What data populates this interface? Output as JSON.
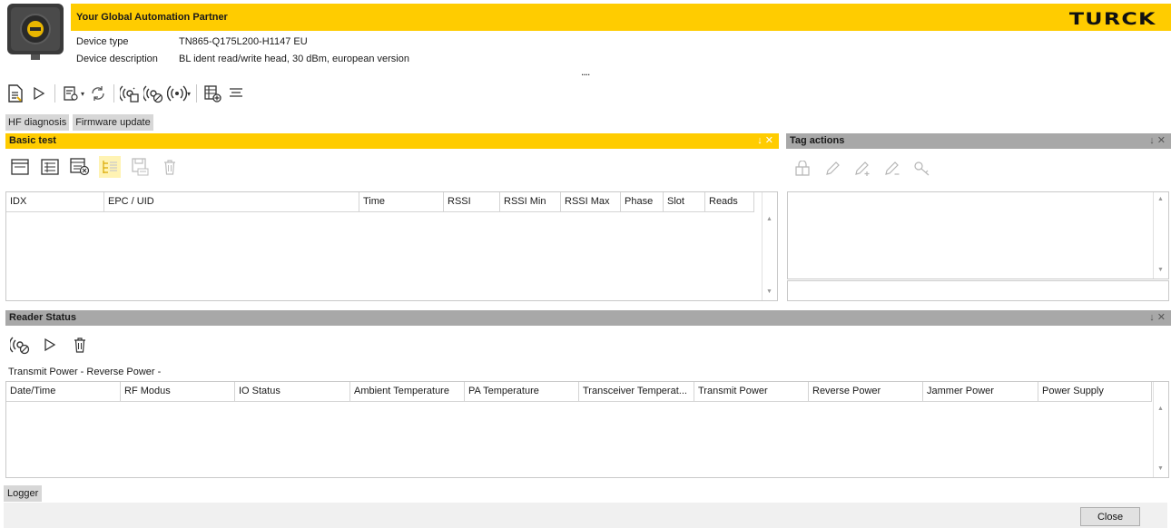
{
  "header": {
    "tagline": "Your Global Automation Partner",
    "brand": "TURCK",
    "device_type_label": "Device type",
    "device_type_value": "TN865-Q175L200-H1147 EU",
    "device_desc_label": "Device description",
    "device_desc_value": "BL ident read/write head, 30 dBm, european version",
    "more": "...."
  },
  "toolbar": {
    "items": [
      "report-icon",
      "play-icon",
      "config-icon",
      "refresh-icon",
      "antenna-tag-icon",
      "antenna-check-icon",
      "wireless-icon",
      "table-add-icon",
      "align-icon"
    ]
  },
  "tabs": [
    "HF diagnosis",
    "Firmware update"
  ],
  "basic_test": {
    "title": "Basic test",
    "pin": "↓ ✕",
    "columns": [
      "IDX",
      "EPC / UID",
      "Time",
      "RSSI",
      "RSSI Min",
      "RSSI Max",
      "Phase",
      "Slot",
      "Reads"
    ]
  },
  "tag_actions": {
    "title": "Tag actions",
    "pin": "↓ ✕"
  },
  "reader_status": {
    "title": "Reader Status",
    "pin": "↓ ✕",
    "power_line": "Transmit Power -   Reverse Power -",
    "columns": [
      "Date/Time",
      "RF Modus",
      "IO Status",
      "Ambient Temperature",
      "PA Temperature",
      "Transceiver Temperat...",
      "Transmit Power",
      "Reverse Power",
      "Jammer Power",
      "Power Supply"
    ]
  },
  "logger": "Logger",
  "close_label": "Close",
  "colors": {
    "accent": "#ffcc00",
    "panel_gray": "#a8a8a8"
  }
}
